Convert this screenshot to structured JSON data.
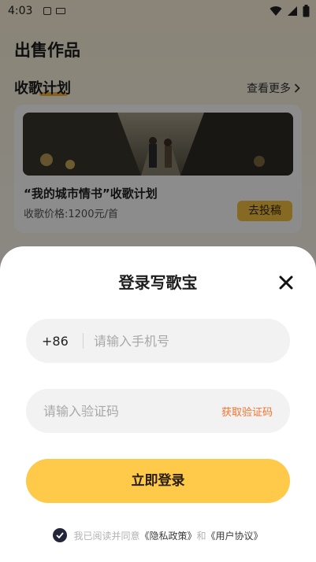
{
  "status_bar": {
    "time": "4:03"
  },
  "page": {
    "title": "出售作品",
    "section_title": "收歌计划",
    "see_more": "查看更多"
  },
  "card": {
    "title": "“我的城市情书”收歌计划",
    "price": "收歌价格:1200元/首",
    "submit_label": "去投稿"
  },
  "login_sheet": {
    "title": "登录写歌宝",
    "country_code": "+86",
    "phone_placeholder": "请输入手机号",
    "code_placeholder": "请输入验证码",
    "get_code_label": "获取验证码",
    "login_label": "立即登录",
    "agreement": {
      "prefix": "我已阅读并同意",
      "privacy": "《隐私政策》",
      "and": "和",
      "user_agreement": "《用户协议》"
    }
  },
  "colors": {
    "accent": "#ffc94a",
    "link_orange": "#f2732e",
    "check_dark": "#23263a"
  }
}
